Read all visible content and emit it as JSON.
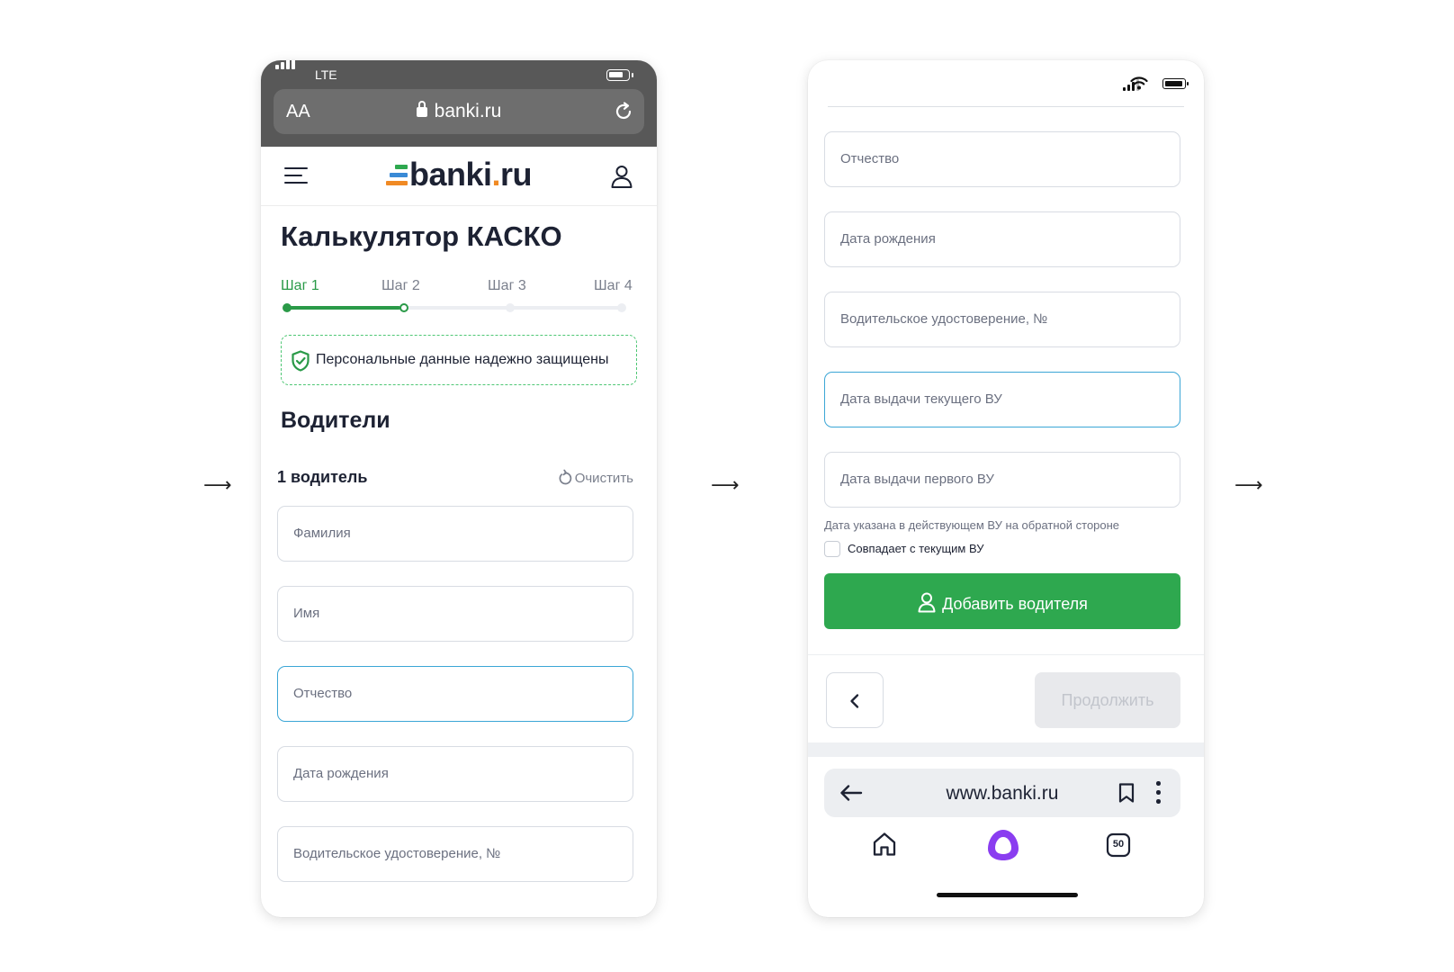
{
  "phone1": {
    "status": {
      "carrier": "LTE"
    },
    "browser": {
      "text_size_button": "AA",
      "url": "banki.ru"
    },
    "header": {
      "logo_main": "banki",
      "logo_dot": ".",
      "logo_tld": "ru"
    },
    "title": "Калькулятор КАСКО",
    "steps": [
      {
        "label": "Шаг 1"
      },
      {
        "label": "Шаг 2"
      },
      {
        "label": "Шаг 3"
      },
      {
        "label": "Шаг 4"
      }
    ],
    "steps_progress": 0.34,
    "secure_notice": "Персональные данные надежно защищены",
    "section_title": "Водители",
    "driver_label": "1 водитель",
    "clear_label": "Очистить",
    "fields": [
      {
        "placeholder": "Фамилия"
      },
      {
        "placeholder": "Имя"
      },
      {
        "placeholder": "Отчество"
      },
      {
        "placeholder": "Дата рождения"
      },
      {
        "placeholder": "Водительское удостоверение, №"
      }
    ]
  },
  "phone2": {
    "fields": [
      {
        "placeholder": "Отчество"
      },
      {
        "placeholder": "Дата рождения"
      },
      {
        "placeholder": "Водительское удостоверение, №"
      },
      {
        "placeholder": "Дата выдачи текущего ВУ"
      },
      {
        "placeholder": "Дата выдачи первого ВУ"
      }
    ],
    "hint": "Дата указана в действующем ВУ на обратной стороне",
    "checkbox_label": "Совпадает с текущим ВУ",
    "add_driver_button": "Добавить водителя",
    "continue_button": "Продолжить",
    "browser": {
      "url": "www.banki.ru",
      "tabs_count": "50"
    }
  },
  "flow_arrow": "⟶",
  "colors": {
    "accent_green": "#2ea84f",
    "focus_blue": "#3ba6d6",
    "logo_orange": "#f08a24",
    "alice_purple": "#8a3df0"
  }
}
